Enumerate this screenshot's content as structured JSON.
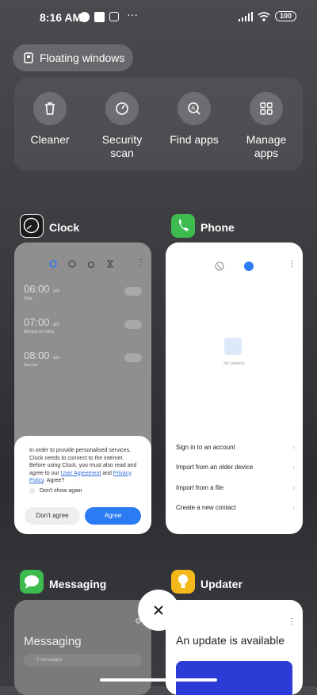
{
  "status_bar": {
    "time": "8:16 AM",
    "battery": "100"
  },
  "floating_windows": {
    "label": "Floating windows"
  },
  "quick_actions": [
    {
      "label": "Cleaner",
      "icon": "trash-icon"
    },
    {
      "label": "Security\nscan",
      "icon": "shield-check-icon"
    },
    {
      "label": "Find apps",
      "icon": "search-apps-icon"
    },
    {
      "label": "Manage\napps",
      "icon": "grid-icon"
    }
  ],
  "apps": {
    "clock": {
      "name": "Clock",
      "alarms": [
        {
          "time": "06:00",
          "ampm": "am",
          "sub": "Daily"
        },
        {
          "time": "07:00",
          "ampm": "am",
          "sub": "Monday to Friday"
        },
        {
          "time": "08:00",
          "ampm": "am",
          "sub": "Sat-Sun"
        }
      ],
      "dialog": {
        "text_before": "In order to provide personalised services, Clock needs to connect to the internet. Before using Clock, you must also read and agree to our ",
        "link1": "User Agreement",
        "and": " and ",
        "link2": "Privacy Policy",
        "text_after": ". Agree?",
        "checkbox": "Don't show again",
        "dont_agree": "Don't agree",
        "agree": "Agree"
      }
    },
    "phone": {
      "name": "Phone",
      "empty": "No contacts",
      "items": [
        "Sign in to an account",
        "Import from an older device",
        "Import from a file",
        "Create a new contact"
      ]
    },
    "messaging": {
      "name": "Messaging",
      "title": "Messaging",
      "search": "0 messages"
    },
    "updater": {
      "name": "Updater",
      "title": "An update is available"
    }
  },
  "colors": {
    "clock_icon": "#1b1b1b",
    "phone_icon": "#3dbb4f",
    "messaging_icon": "#3dbb4f",
    "updater_icon": "#f5b81b",
    "accent": "#2b7cf4"
  }
}
